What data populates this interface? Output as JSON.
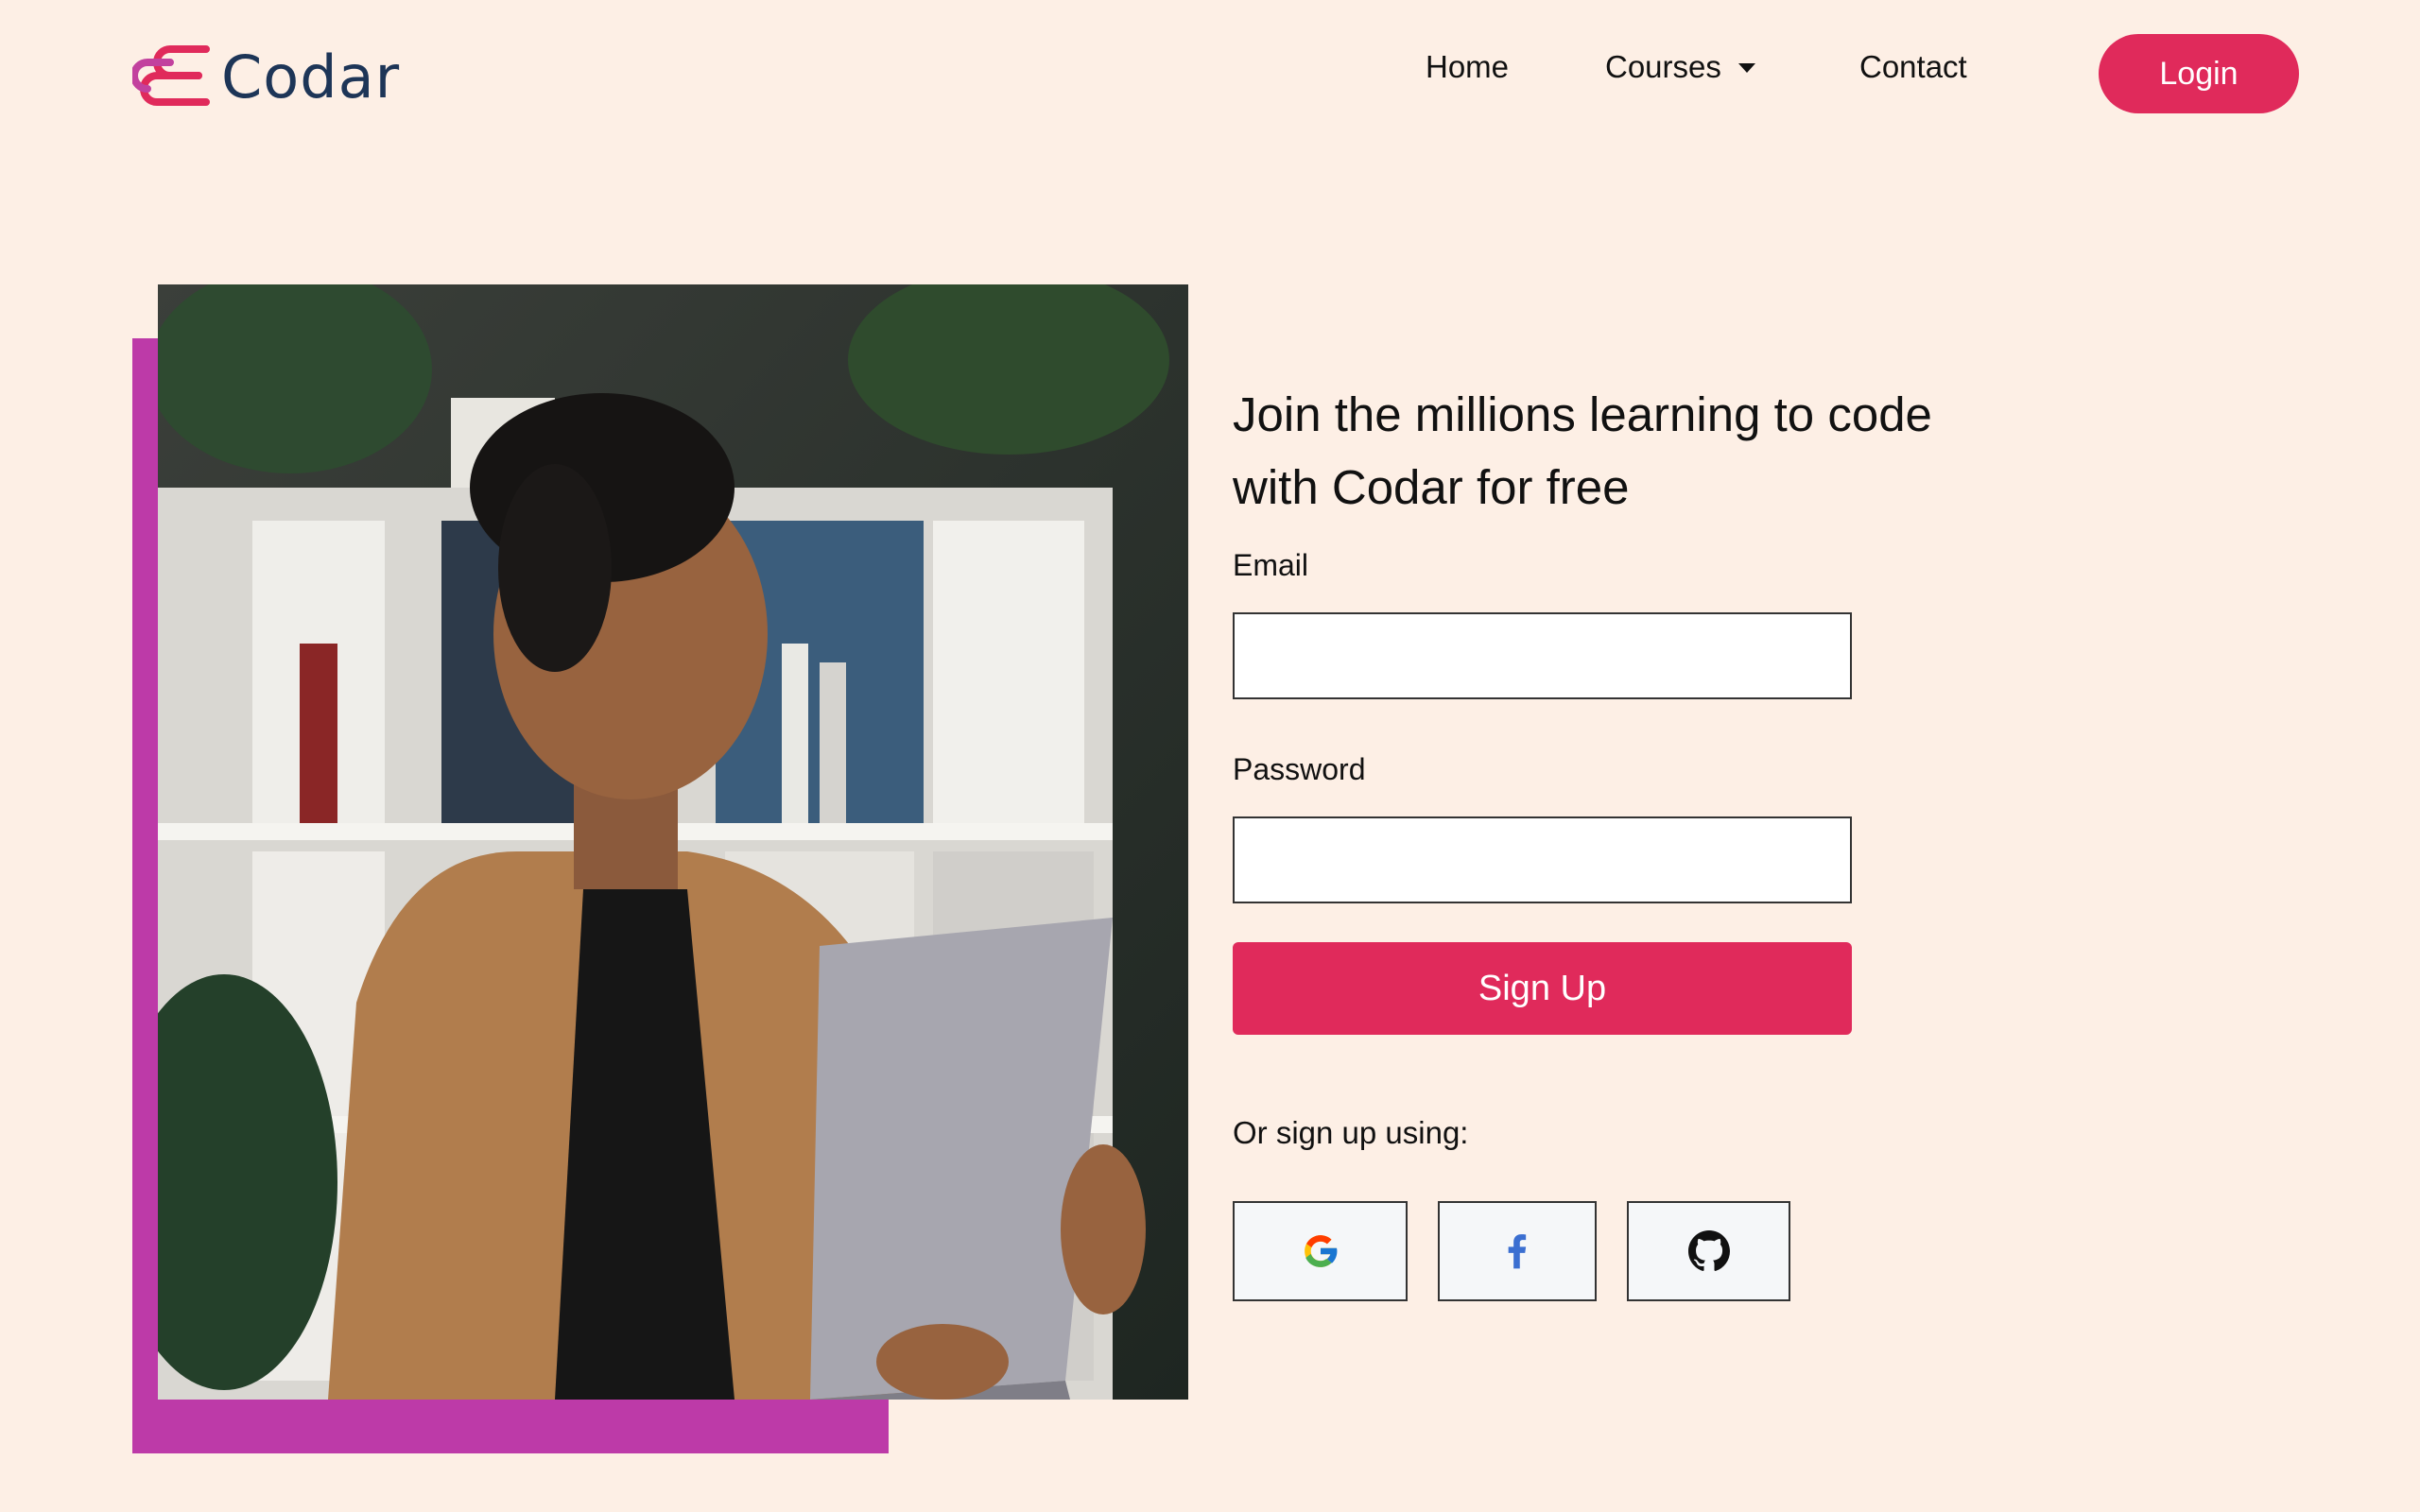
{
  "brand": {
    "name": "Codar",
    "color": "#e02a5b",
    "text_color": "#1d3557"
  },
  "nav": {
    "home": "Home",
    "courses": "Courses",
    "contact": "Contact",
    "login": "Login"
  },
  "hero": {
    "image": "woman-holding-laptop-photo",
    "accent_color": "#bd3aa8"
  },
  "form": {
    "headline_line1": "Join the millions learning to code",
    "headline_line2": "with Codar for free",
    "email_label": "Email",
    "email_value": "",
    "password_label": "Password",
    "password_value": "",
    "signup_label": "Sign Up",
    "alt_text": "Or sign up using:",
    "providers": [
      "google-icon",
      "facebook-icon",
      "github-icon"
    ]
  },
  "colors": {
    "background": "#fdefe5",
    "primary": "#e02a5b"
  }
}
